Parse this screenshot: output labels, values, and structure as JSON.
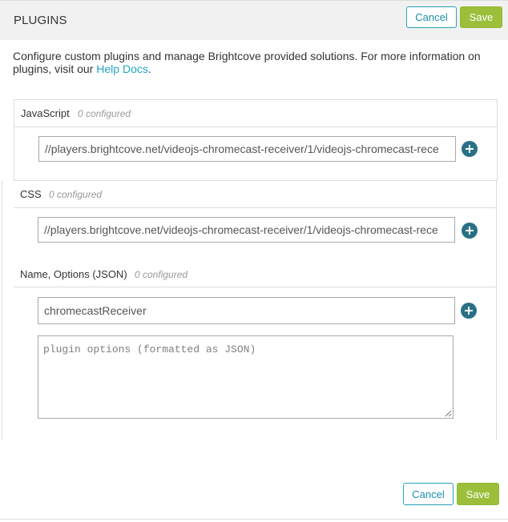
{
  "header": {
    "title": "PLUGINS",
    "cancel_label": "Cancel",
    "save_label": "Save"
  },
  "intro": {
    "text": "Configure custom plugins and manage Brightcove provided solutions. For more information on plugins, visit our ",
    "link_label": "Help Docs",
    "suffix": "."
  },
  "sections": {
    "javascript": {
      "label": "JavaScript",
      "count": "0 configured",
      "input_value": "//players.brightcove.net/videojs-chromecast-receiver/1/videojs-chromecast-rece"
    },
    "css": {
      "label": "CSS",
      "count": "0 configured",
      "input_value": "//players.brightcove.net/videojs-chromecast-receiver/1/videojs-chromecast-rece"
    },
    "json": {
      "label": "Name, Options (JSON)",
      "count": "0 configured",
      "name_value": "chromecastReceiver",
      "options_placeholder": "plugin options (formatted as JSON)"
    }
  },
  "footer": {
    "cancel_label": "Cancel",
    "save_label": "Save"
  },
  "colors": {
    "accent": "#26a2bb",
    "save": "#9bbf3b",
    "add_icon": "#287085",
    "header_bg": "#f1f1f1"
  },
  "icons": {
    "add": "plus-circle-icon"
  }
}
